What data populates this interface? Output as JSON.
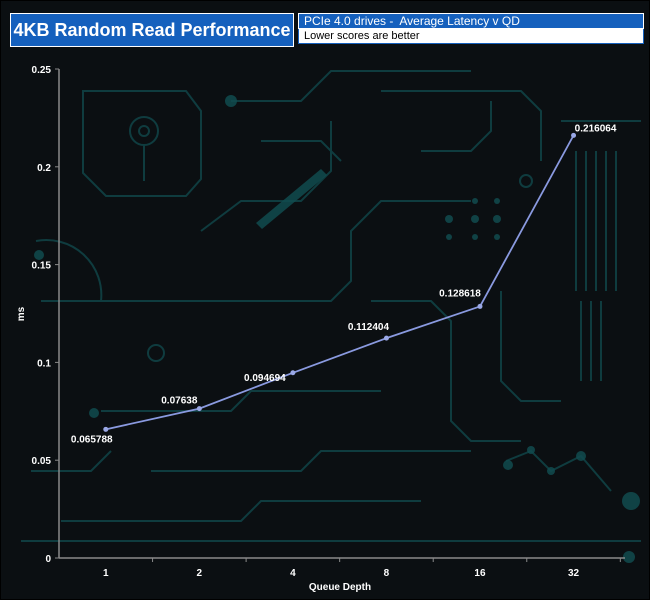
{
  "title": "4KB Random Read Performance",
  "subtitle": "PCIe 4.0 drives -  Average Latency v QD",
  "note": "Lower scores are better",
  "colors": {
    "header_bg": "#1560bd",
    "line": "#8a9ae0",
    "marker": "#9aa8e6",
    "text": "#ffffff"
  },
  "chart_data": {
    "type": "line",
    "title": "4KB Random Read Performance",
    "subtitle": "PCIe 4.0 drives -  Average Latency v QD",
    "xlabel": "Queue Depth",
    "ylabel": "ms",
    "categories": [
      "1",
      "2",
      "4",
      "8",
      "16",
      "32"
    ],
    "values": [
      0.065788,
      0.07638,
      0.094694,
      0.112404,
      0.128618,
      0.216064
    ],
    "data_labels": [
      "0.065788",
      "0.07638",
      "0.094694",
      "0.112404",
      "0.128618",
      "0.216064"
    ],
    "y_ticks": [
      "0",
      "0.05",
      "0.1",
      "0.15",
      "0.2",
      "0.25"
    ],
    "ylim": [
      0,
      0.25
    ],
    "grid": false,
    "legend": "none"
  }
}
